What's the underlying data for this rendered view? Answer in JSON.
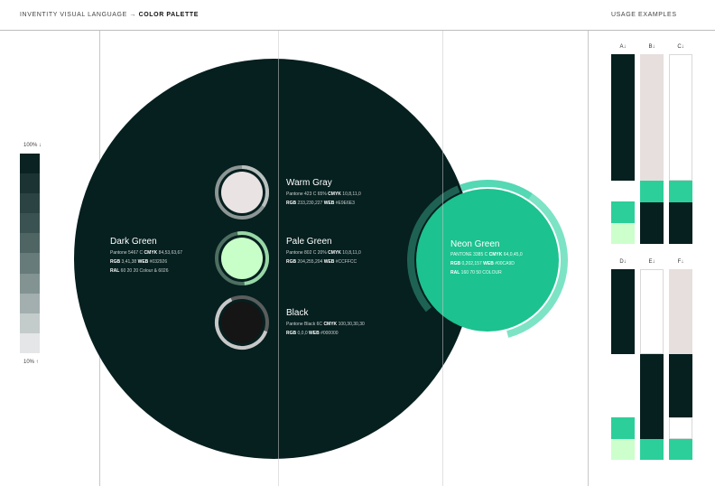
{
  "header": {
    "breadcrumb": "INVENTITY VISUAL LANGUAGE",
    "arrow": "→",
    "section": "COLOR PALETTE",
    "usage": "USAGE EXAMPLES"
  },
  "scale": {
    "top_label": "100% ↓",
    "bottom_label": "10% ↑",
    "steps": [
      "#0b2222",
      "#1b3433",
      "#2b4443",
      "#3a5251",
      "#4e6564",
      "#677b7a",
      "#829392",
      "#a2afae",
      "#c4cbcb",
      "#e4e6e8"
    ]
  },
  "colors": {
    "dark_green": {
      "name": "Dark Green",
      "hex": "#032926",
      "line1_a": "Pantone",
      "line1_b": "5467 C",
      "line1_c": "CMYK",
      "line1_d": "84,53,63,67",
      "line2_a": "RGB",
      "line2_b": "3,41,38",
      "line2_c": "WEB",
      "line2_d": "#032926",
      "line3_a": "RAL",
      "line3_b": "60 20 20 Colour & 6026"
    },
    "warm_gray": {
      "name": "Warm Gray",
      "hex": "#E9E6E3",
      "line1_a": "Pantone",
      "line1_b": "423 C 65%",
      "line1_c": "CMYK",
      "line1_d": "10,8,11,0",
      "line2_a": "RGB",
      "line2_b": "233,230,227",
      "line2_c": "WEB",
      "line2_d": "#E9E6E3"
    },
    "pale_green": {
      "name": "Pale Green",
      "hex": "#CCFFCC",
      "line1_a": "Pantone",
      "line1_b": "802 C 20%",
      "line1_c": "CMYK",
      "line1_d": "10,8,11,0",
      "line2_a": "RGB",
      "line2_b": "204,255,204",
      "line2_c": "WEB",
      "line2_d": "#CCFFCC"
    },
    "black": {
      "name": "Black",
      "hex": "#000000",
      "line1_a": "Pantone",
      "line1_b": "Black 6C",
      "line1_c": "CMYK",
      "line1_d": "100,30,30,30",
      "line2_a": "RGB",
      "line2_b": "0,0,0",
      "line2_c": "WEB",
      "line2_d": "#000000"
    },
    "neon_green": {
      "name": "Neon Green",
      "hex": "#00CA9D",
      "line1_a": "PANTONE",
      "line1_b": "3385 C",
      "line1_c": "CMYK",
      "line1_d": "64,0,45,0",
      "line2_a": "RGB",
      "line2_b": "0,202,157",
      "line2_c": "WEB",
      "line2_d": "#00CA9D",
      "line3_a": "RAL",
      "line3_b": "160 70 50 COLOUR"
    }
  },
  "usage_columns": [
    "A↓",
    "B↓",
    "C↓",
    "D↓",
    "E↓",
    "F↓"
  ]
}
